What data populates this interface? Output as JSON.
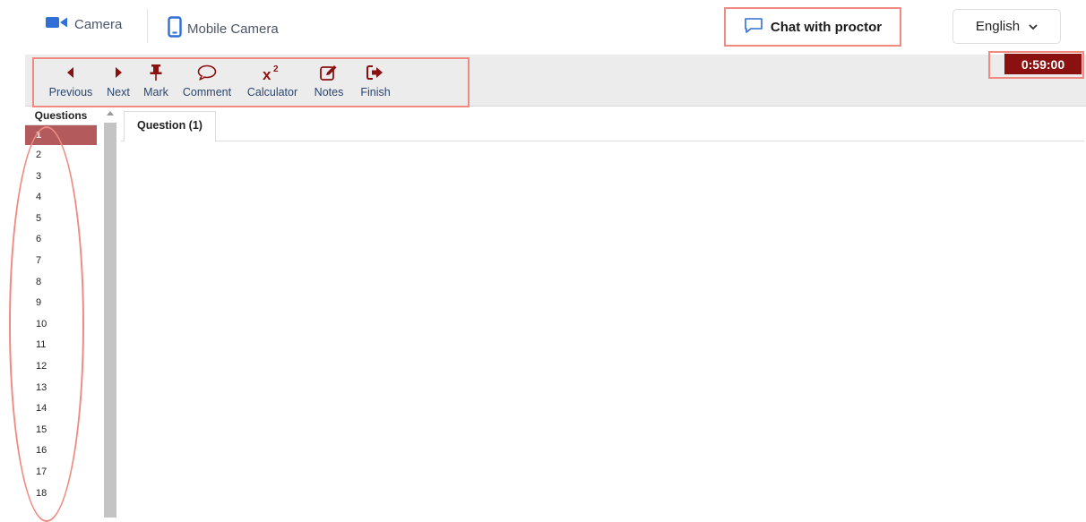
{
  "topbar": {
    "camera_label": "Camera",
    "camera_icon": "video-camera-icon",
    "mobile_camera_label": "Mobile Camera",
    "mobile_icon": "mobile-phone-icon",
    "chat_label": "Chat with proctor",
    "chat_icon": "chat-bubble-icon",
    "language": "English"
  },
  "toolbar": {
    "items": [
      {
        "label": "Previous",
        "icon": "arrow-left-icon"
      },
      {
        "label": "Next",
        "icon": "arrow-right-icon"
      },
      {
        "label": "Mark",
        "icon": "pushpin-icon"
      },
      {
        "label": "Comment",
        "icon": "speech-bubble-icon"
      },
      {
        "label": "Calculator",
        "icon": "superscript-icon"
      },
      {
        "label": "Notes",
        "icon": "edit-icon"
      },
      {
        "label": "Finish",
        "icon": "sign-out-icon"
      }
    ]
  },
  "timer": "0:59:00",
  "questions": {
    "header": "Questions",
    "items": [
      "1",
      "2",
      "3",
      "4",
      "5",
      "6",
      "7",
      "8",
      "9",
      "10",
      "11",
      "12",
      "13",
      "14",
      "15",
      "16",
      "17",
      "18"
    ],
    "active": "1"
  },
  "content": {
    "tab_label": "Question (1)"
  },
  "colors": {
    "accent": "#8b1111",
    "active_question": "#b35a5c",
    "annotation": "#f08a80",
    "toolbar_label": "#2a4570",
    "icon_blue": "#2f6fd6"
  }
}
